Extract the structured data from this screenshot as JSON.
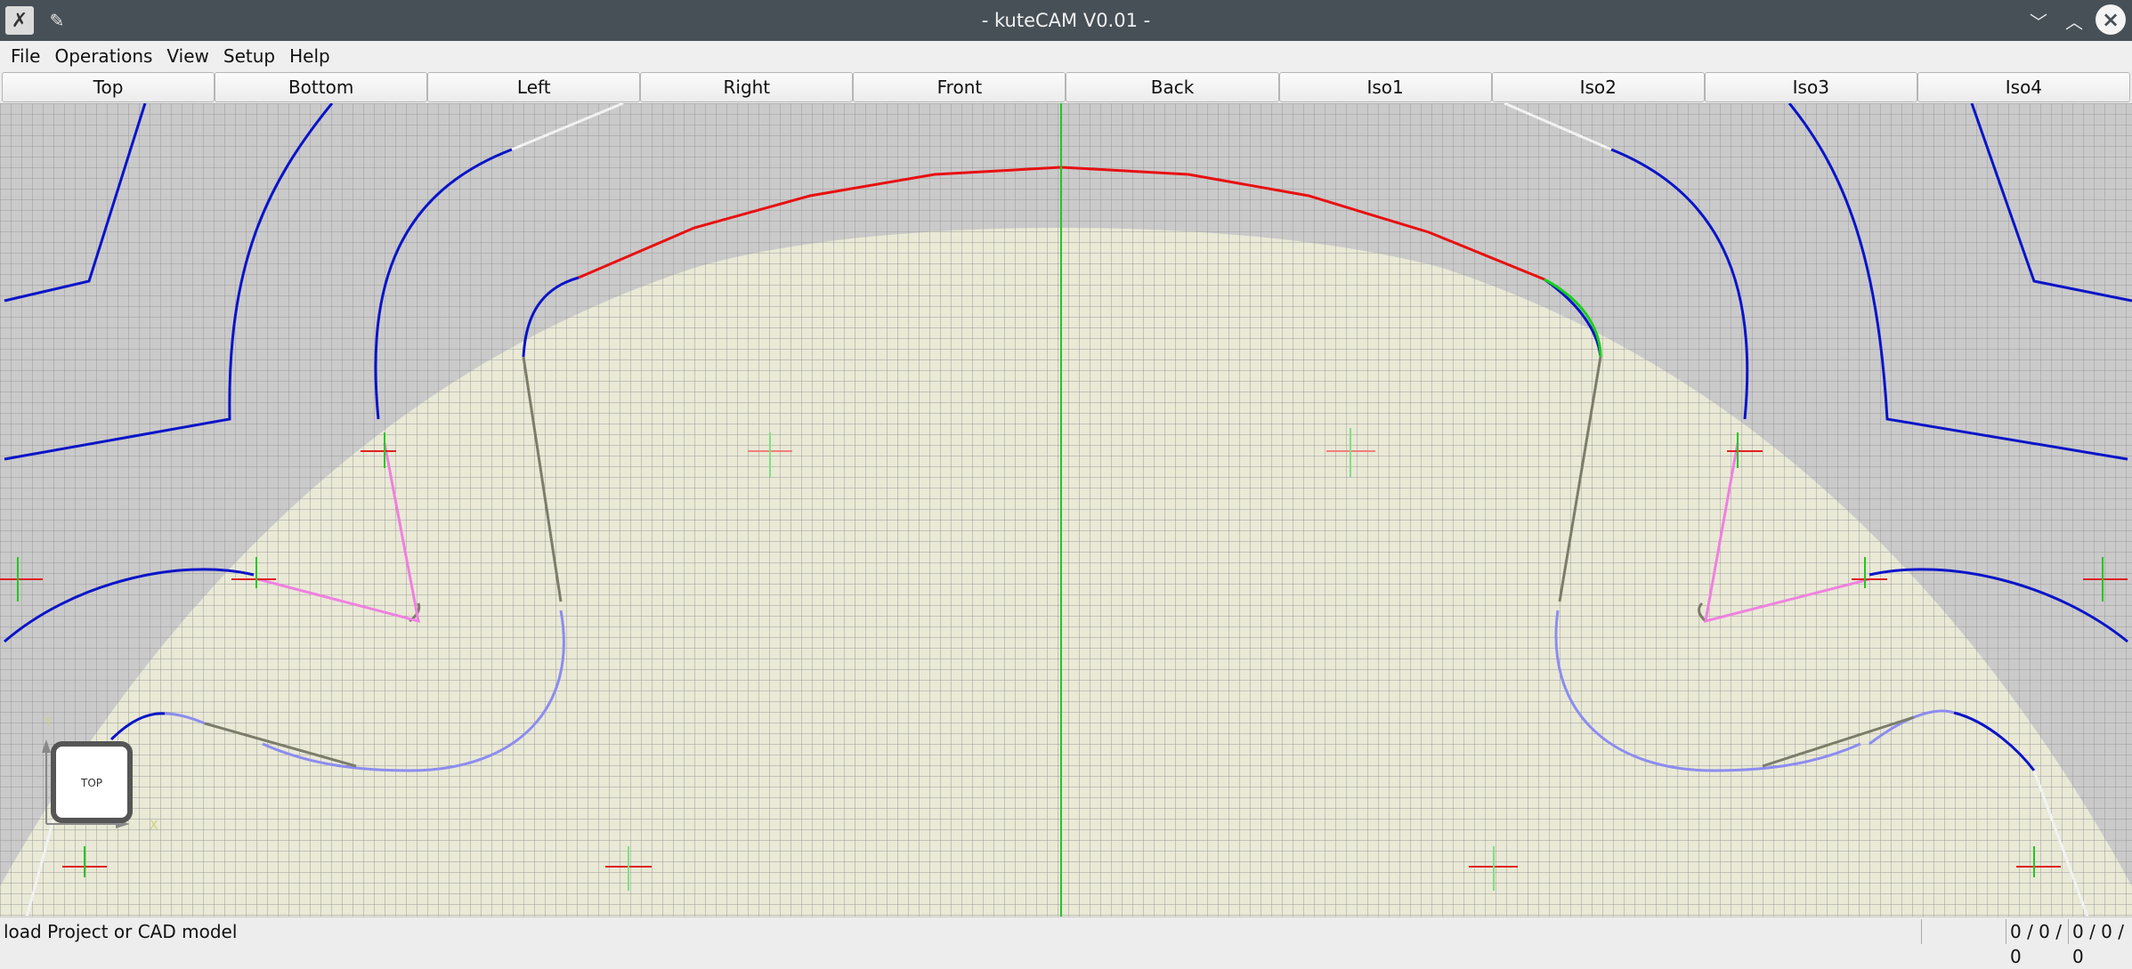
{
  "window": {
    "title": "- kuteCAM V0.01 -",
    "app_icon": "app-icon",
    "pin_icon": "pin-icon",
    "minimize_icon": "chevron-down-icon",
    "maximize_icon": "chevron-up-icon",
    "close_icon": "close-icon"
  },
  "menu": {
    "items": [
      {
        "label": "File"
      },
      {
        "label": "Operations"
      },
      {
        "label": "View"
      },
      {
        "label": "Setup"
      },
      {
        "label": "Help"
      }
    ]
  },
  "views": {
    "buttons": [
      {
        "label": "Top"
      },
      {
        "label": "Bottom"
      },
      {
        "label": "Left"
      },
      {
        "label": "Right"
      },
      {
        "label": "Front"
      },
      {
        "label": "Back"
      },
      {
        "label": "Iso1"
      },
      {
        "label": "Iso2"
      },
      {
        "label": "Iso3"
      },
      {
        "label": "Iso4"
      }
    ]
  },
  "viewport": {
    "view_cube_label": "TOP",
    "colors": {
      "background": "#cacaca",
      "grid": "#9a9a9a",
      "stock": "#e9e9d6",
      "contour": "#0a14c8",
      "contour_light": "#8c8cf0",
      "toolpath_selected": "#e81010",
      "toolpath_green": "#18d018",
      "gray_path": "#7c7c6a",
      "pink_path": "#f080e0",
      "white_path": "#f2f2f2",
      "axis_x": "#e02020",
      "axis_y": "#20c820"
    }
  },
  "status": {
    "message": "load Project or CAD model",
    "counter_1": "0 / 0 / 0",
    "counter_2": "0 / 0 / 0"
  }
}
